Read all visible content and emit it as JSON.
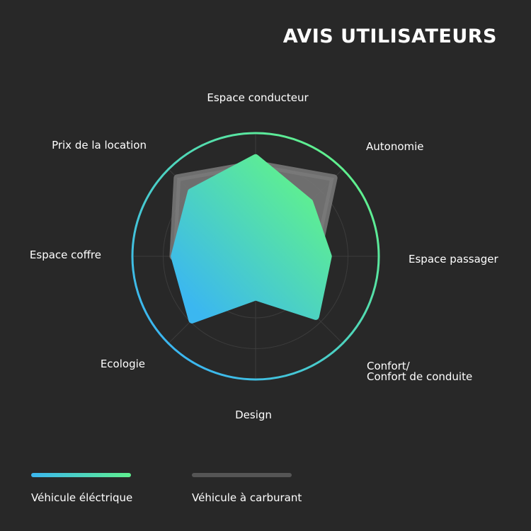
{
  "title": "AVIS UTILISATEURS",
  "chart_data": {
    "type": "radar",
    "axes": [
      "Espace conducteur",
      "Autonomie",
      "Espace passager",
      "Confort/\nConfort de conduite",
      "Design",
      "Ecologie",
      "Espace coffre",
      "Prix de la location"
    ],
    "rmax": 10,
    "rings": [
      2.5,
      5,
      7.5
    ],
    "grid": true,
    "series": [
      {
        "name": "Véhicule à carburant",
        "color": "#7a7a7a",
        "opacity": 0.85,
        "values": [
          7.5,
          9,
          5,
          5.5,
          3.3,
          5,
          6.7,
          9
        ]
      },
      {
        "name": "Véhicule éléctrique",
        "gradient": [
          "#3bb7f0",
          "#5ff08f"
        ],
        "values": [
          8,
          6.2,
          5.9,
          6.9,
          3.3,
          7.3,
          6.6,
          7.4
        ]
      }
    ],
    "outer_ring_gradient": [
      "#3bb7f0",
      "#5ff08f"
    ]
  },
  "legend": [
    {
      "label": "Véhicule éléctrique",
      "colors": [
        "#3bb7f0",
        "#5ff08f"
      ]
    },
    {
      "label": "Véhicule à carburant",
      "colors": [
        "#555555",
        "#555555"
      ]
    }
  ]
}
